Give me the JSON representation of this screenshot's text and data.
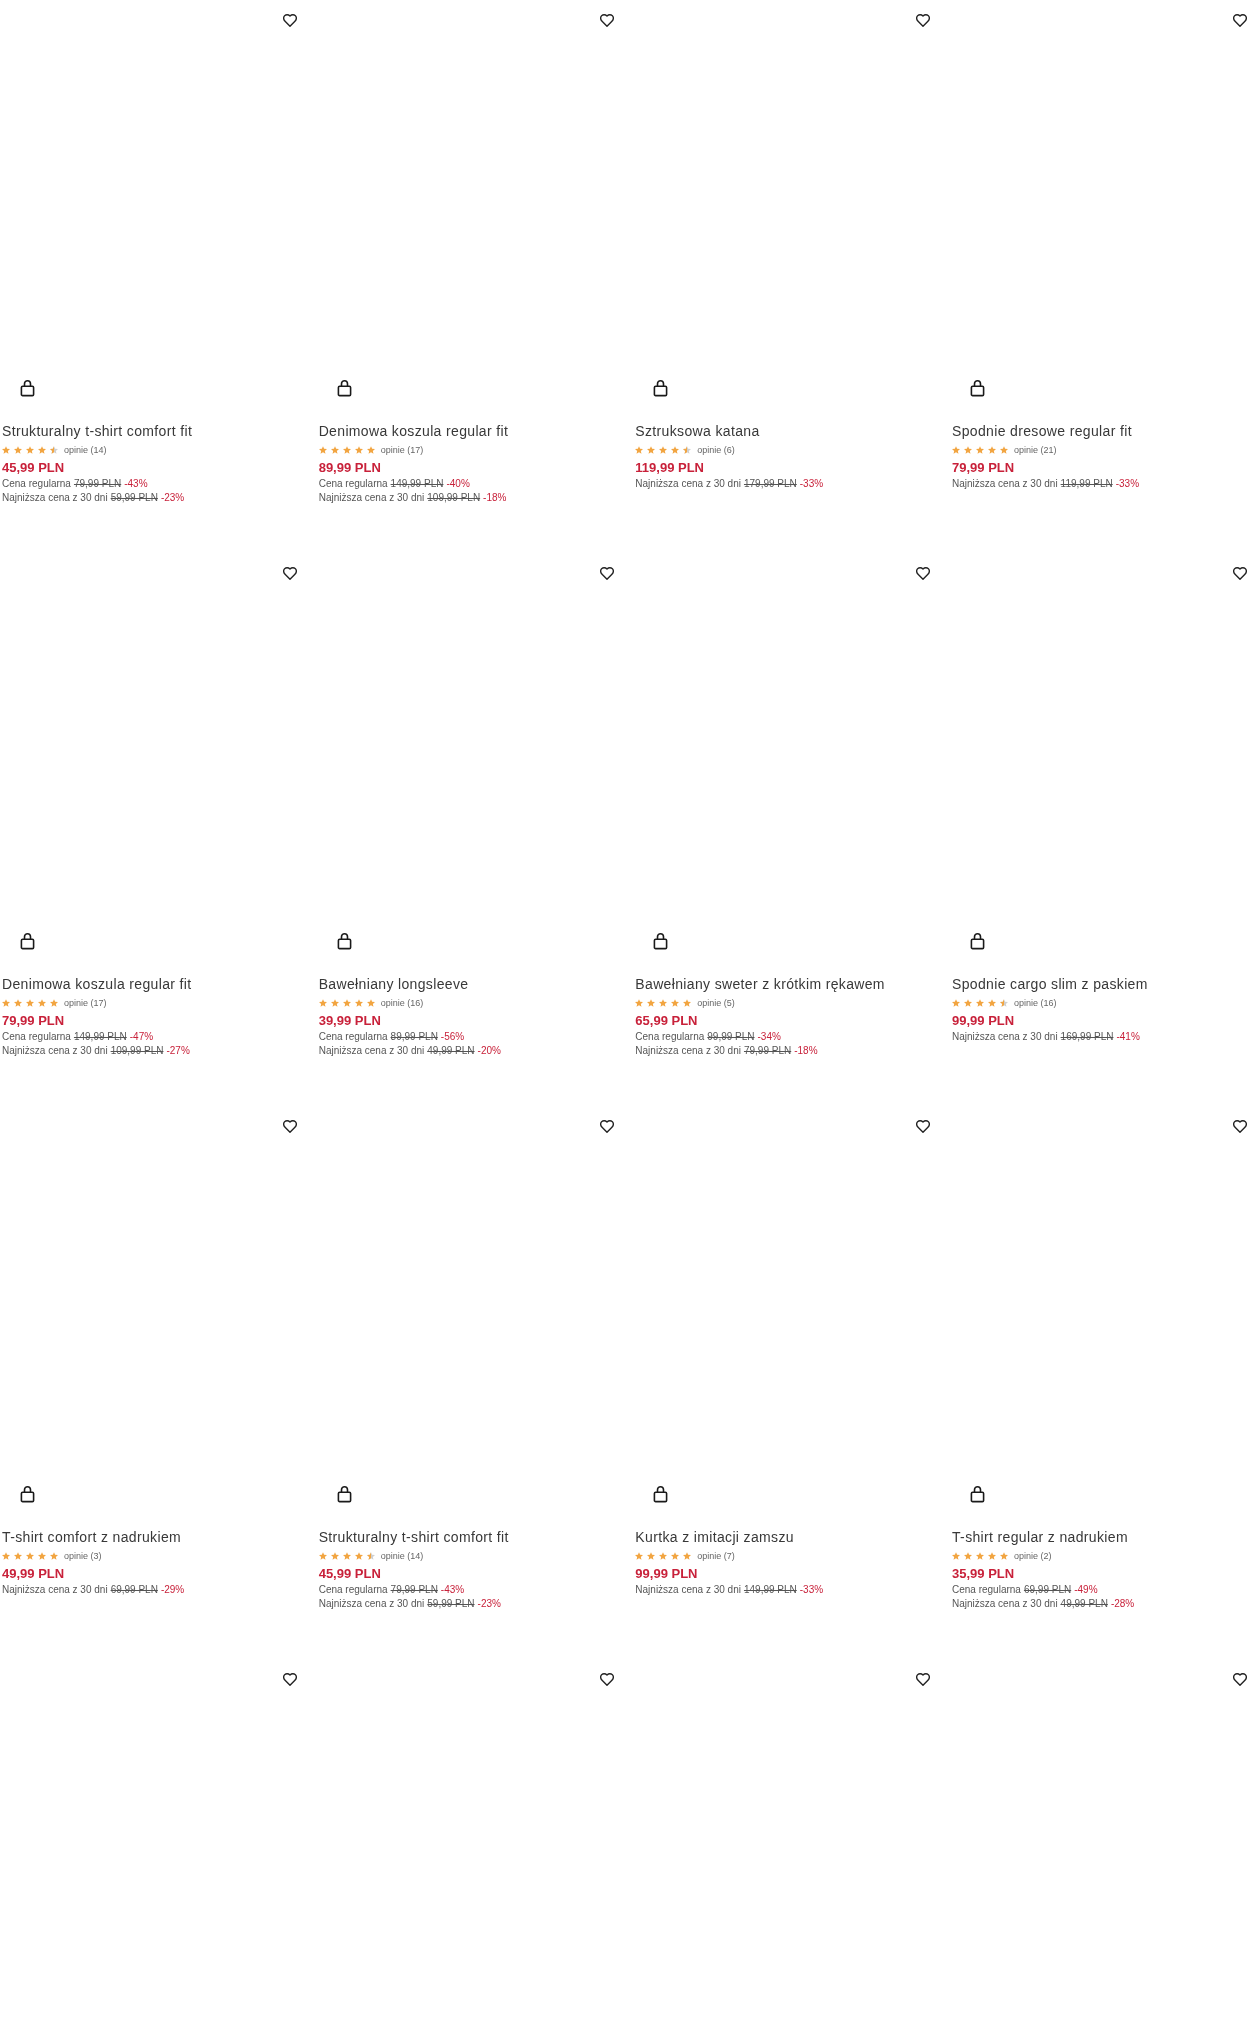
{
  "products": [
    {
      "kind": "full",
      "name": "Strukturalny t-shirt comfort fit",
      "stars": 4.5,
      "reviews": "opinie (14)",
      "price": "45,99 PLN",
      "price_notes": [
        {
          "label": "Cena regularna",
          "old_price": "79,99 PLN",
          "discount": "-43%"
        },
        {
          "label": "Najniższa cena z 30 dni",
          "old_price": "59,99 PLN",
          "discount": "-23%"
        }
      ]
    },
    {
      "kind": "full",
      "name": "Denimowa koszula regular fit",
      "stars": 5,
      "reviews": "opinie (17)",
      "price": "89,99 PLN",
      "price_notes": [
        {
          "label": "Cena regularna",
          "old_price": "149,99 PLN",
          "discount": "-40%"
        },
        {
          "label": "Najniższa cena z 30 dni",
          "old_price": "109,99 PLN",
          "discount": "-18%"
        }
      ]
    },
    {
      "kind": "full",
      "name": "Sztruksowa katana",
      "stars": 4.5,
      "reviews": "opinie (6)",
      "price": "119,99 PLN",
      "price_notes": [
        {
          "label": "Najniższa cena z 30 dni",
          "old_price": "179,99 PLN",
          "discount": "-33%"
        }
      ]
    },
    {
      "kind": "full",
      "name": "Spodnie dresowe regular fit",
      "stars": 5,
      "reviews": "opinie (21)",
      "price": "79,99 PLN",
      "price_notes": [
        {
          "label": "Najniższa cena z 30 dni",
          "old_price": "119,99 PLN",
          "discount": "-33%"
        }
      ]
    },
    {
      "kind": "full",
      "name": "Denimowa koszula regular fit",
      "stars": 5,
      "reviews": "opinie (17)",
      "price": "79,99 PLN",
      "price_notes": [
        {
          "label": "Cena regularna",
          "old_price": "149,99 PLN",
          "discount": "-47%"
        },
        {
          "label": "Najniższa cena z 30 dni",
          "old_price": "109,99 PLN",
          "discount": "-27%"
        }
      ]
    },
    {
      "kind": "full",
      "name": "Bawełniany longsleeve",
      "stars": 5,
      "reviews": "opinie (16)",
      "price": "39,99 PLN",
      "price_notes": [
        {
          "label": "Cena regularna",
          "old_price": "89,99 PLN",
          "discount": "-56%"
        },
        {
          "label": "Najniższa cena z 30 dni",
          "old_price": "49,99 PLN",
          "discount": "-20%"
        }
      ]
    },
    {
      "kind": "full",
      "name": "Bawełniany sweter z krótkim rękawem",
      "stars": 5,
      "reviews": "opinie (5)",
      "price": "65,99 PLN",
      "price_notes": [
        {
          "label": "Cena regularna",
          "old_price": "99,99 PLN",
          "discount": "-34%"
        },
        {
          "label": "Najniższa cena z 30 dni",
          "old_price": "79,99 PLN",
          "discount": "-18%"
        }
      ]
    },
    {
      "kind": "full",
      "name": "Spodnie cargo slim z paskiem",
      "stars": 4.5,
      "reviews": "opinie (16)",
      "price": "99,99 PLN",
      "price_notes": [
        {
          "label": "Najniższa cena z 30 dni",
          "old_price": "169,99 PLN",
          "discount": "-41%"
        }
      ]
    },
    {
      "kind": "full",
      "name": "T-shirt comfort z nadrukiem",
      "stars": 5,
      "reviews": "opinie (3)",
      "price": "49,99 PLN",
      "price_notes": [
        {
          "label": "Najniższa cena z 30 dni",
          "old_price": "69,99 PLN",
          "discount": "-29%"
        }
      ]
    },
    {
      "kind": "full",
      "name": "Strukturalny t-shirt comfort fit",
      "stars": 4.5,
      "reviews": "opinie (14)",
      "price": "45,99 PLN",
      "price_notes": [
        {
          "label": "Cena regularna",
          "old_price": "79,99 PLN",
          "discount": "-43%"
        },
        {
          "label": "Najniższa cena z 30 dni",
          "old_price": "59,99 PLN",
          "discount": "-23%"
        }
      ]
    },
    {
      "kind": "full",
      "name": "Kurtka z imitacji zamszu",
      "stars": 5,
      "reviews": "opinie (7)",
      "price": "99,99 PLN",
      "price_notes": [
        {
          "label": "Najniższa cena z 30 dni",
          "old_price": "149,99 PLN",
          "discount": "-33%"
        }
      ]
    },
    {
      "kind": "full",
      "name": "T-shirt regular z nadrukiem",
      "stars": 5,
      "reviews": "opinie (2)",
      "price": "35,99 PLN",
      "price_notes": [
        {
          "label": "Cena regularna",
          "old_price": "69,99 PLN",
          "discount": "-49%"
        },
        {
          "label": "Najniższa cena z 30 dni",
          "old_price": "49,99 PLN",
          "discount": "-28%"
        }
      ]
    },
    {
      "kind": "image_only"
    },
    {
      "kind": "image_only"
    },
    {
      "kind": "image_only"
    },
    {
      "kind": "image_only"
    }
  ]
}
